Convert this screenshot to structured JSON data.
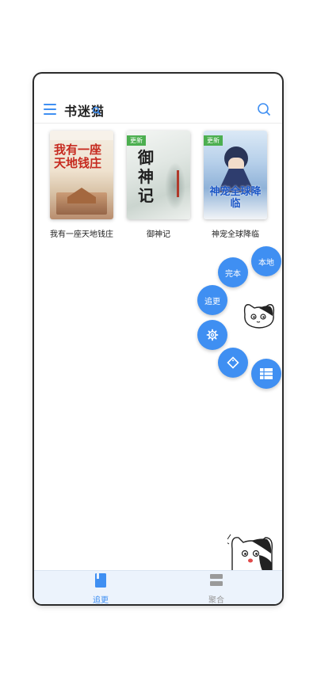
{
  "header": {
    "title": "书迷猫",
    "menu_icon": "menu-icon",
    "search_icon": "search-icon"
  },
  "books": [
    {
      "title": "我有一座天地钱庄",
      "cover_text": "我有一座天地钱庄",
      "badge": ""
    },
    {
      "title": "御神记",
      "cover_text": "御神记",
      "badge": "更新"
    },
    {
      "title": "神宠全球降临",
      "cover_text": "神宠全球降临",
      "badge": "更新"
    }
  ],
  "fab_menu": {
    "local": "本地",
    "finished": "完本",
    "following": "追更",
    "settings_icon": "gear-icon",
    "tag_icon": "tag-icon",
    "list_icon": "list-icon",
    "mascot_icon": "cat-mascot-icon"
  },
  "bottom_tabs": [
    {
      "label": "追更",
      "active": true,
      "icon": "book-icon"
    },
    {
      "label": "聚合",
      "active": false,
      "icon": "stack-icon"
    }
  ],
  "colors": {
    "accent": "#3f8ff2",
    "inactive": "#9a9a9a",
    "badge": "#4caf50"
  }
}
